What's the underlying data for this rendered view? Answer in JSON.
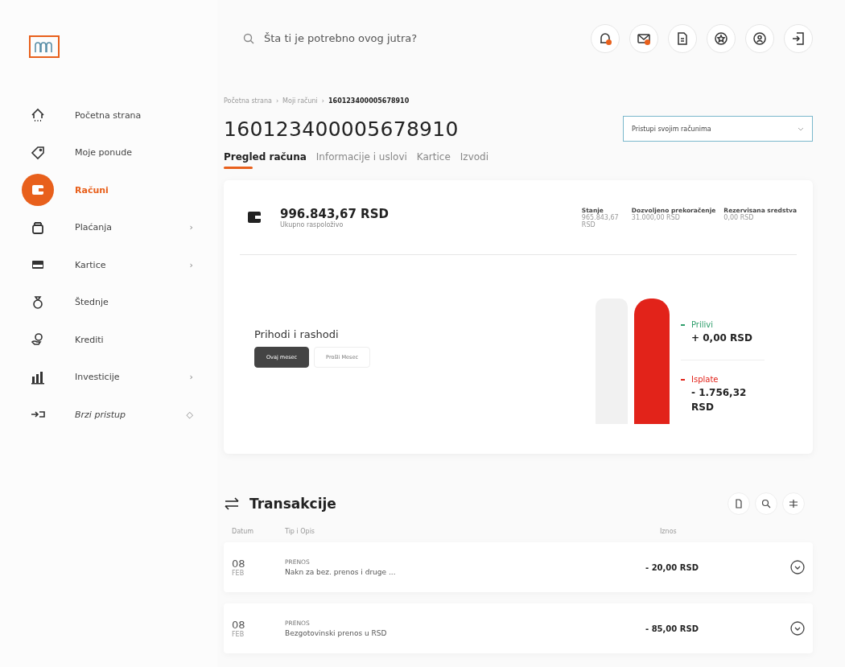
{
  "search": {
    "placeholder": "Šta ti je potrebno ovog jutra?"
  },
  "header_buttons": [
    {
      "kind": "bell",
      "badge": true
    },
    {
      "kind": "mail",
      "badge": true
    },
    {
      "kind": "document",
      "badge": false
    },
    {
      "kind": "star",
      "badge": false
    },
    {
      "kind": "user",
      "badge": false
    },
    {
      "kind": "logout",
      "badge": false
    }
  ],
  "sidebar": {
    "items": [
      {
        "kind": "home",
        "label": "Početna strana",
        "selected": false
      },
      {
        "kind": "tag",
        "label": "Moje ponude",
        "selected": false
      },
      {
        "kind": "wallet",
        "label": "Računi",
        "selected": true
      },
      {
        "kind": "bag",
        "label": "Plaćanja",
        "selected": false,
        "trailing": "›"
      },
      {
        "kind": "card",
        "label": "Kartice",
        "selected": false,
        "trailing": "›"
      },
      {
        "kind": "savings",
        "label": "Štednje",
        "selected": false
      },
      {
        "kind": "loan",
        "label": "Krediti",
        "selected": false
      },
      {
        "kind": "chart",
        "label": "Investicije",
        "selected": false,
        "trailing": "›"
      },
      {
        "kind": "quick",
        "label": "Brzi pristup",
        "selected": false,
        "trailing": "◇"
      }
    ]
  },
  "breadcrumb": [
    "Početna strana",
    "Moji računi",
    "160123400005678910"
  ],
  "breadcrumb_separator": "›",
  "account_number": "160123400005678910",
  "account_select": {
    "value": "Pristupi svojim računima"
  },
  "tabs": [
    {
      "label": "Pregled računa",
      "selected": true
    },
    {
      "label": "Informacije i uslovi",
      "selected": false
    },
    {
      "label": "Kartice",
      "selected": false
    },
    {
      "label": "Izvodi",
      "selected": false
    }
  ],
  "summary": {
    "amount": "996.843,67 RSD",
    "caption": "Ukupno raspoloživo",
    "stats": [
      {
        "label": "Stanje",
        "value": "965.843,67 RSD"
      },
      {
        "label": "Dozvoljeno prekoračenje",
        "value": "31.000,00 RSD"
      },
      {
        "label": "Rezervisana sredstva",
        "value": "0,00 RSD"
      }
    ]
  },
  "income_expenses": {
    "title": "Prihodi i rashodi",
    "periods": [
      {
        "label": "Ovaj mesec",
        "selected": true
      },
      {
        "label": "Prošli Mesec",
        "selected": false
      }
    ],
    "legend": [
      {
        "label": "Prilivi",
        "value": "+ 0,00 RSD",
        "color": "#2e9e6b"
      },
      {
        "label": "Isplate",
        "value": "- 1.756,32 RSD",
        "color": "#e2231a"
      }
    ]
  },
  "transactions": {
    "title": "Transakcije",
    "columns": [
      "Datum",
      "Tip i Opis",
      "Iznos"
    ],
    "rows": [
      {
        "day": "08",
        "month": "FEB",
        "type": "PRENOS",
        "description": "Nakn za bez. prenos i druge ...",
        "amount": "- 20,00 RSD"
      },
      {
        "day": "08",
        "month": "FEB",
        "type": "PRENOS",
        "description": "Bezgotovinski prenos u RSD",
        "amount": "- 85,00 RSD"
      }
    ]
  }
}
